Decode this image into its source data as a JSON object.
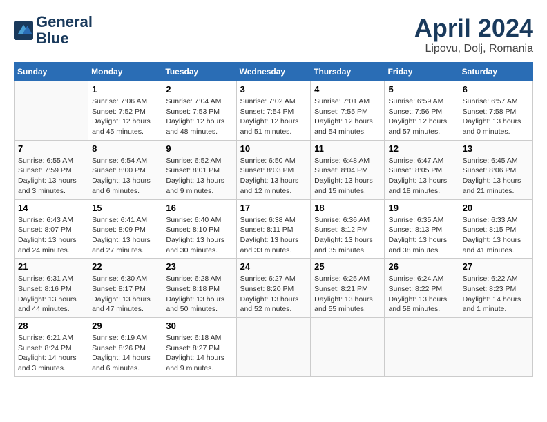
{
  "logo": {
    "line1": "General",
    "line2": "Blue"
  },
  "title": "April 2024",
  "location": "Lipovu, Dolj, Romania",
  "header_days": [
    "Sunday",
    "Monday",
    "Tuesday",
    "Wednesday",
    "Thursday",
    "Friday",
    "Saturday"
  ],
  "weeks": [
    [
      null,
      {
        "day": "1",
        "sunrise": "7:06 AM",
        "sunset": "7:52 PM",
        "daylight": "12 hours and 45 minutes."
      },
      {
        "day": "2",
        "sunrise": "7:04 AM",
        "sunset": "7:53 PM",
        "daylight": "12 hours and 48 minutes."
      },
      {
        "day": "3",
        "sunrise": "7:02 AM",
        "sunset": "7:54 PM",
        "daylight": "12 hours and 51 minutes."
      },
      {
        "day": "4",
        "sunrise": "7:01 AM",
        "sunset": "7:55 PM",
        "daylight": "12 hours and 54 minutes."
      },
      {
        "day": "5",
        "sunrise": "6:59 AM",
        "sunset": "7:56 PM",
        "daylight": "12 hours and 57 minutes."
      },
      {
        "day": "6",
        "sunrise": "6:57 AM",
        "sunset": "7:58 PM",
        "daylight": "13 hours and 0 minutes."
      }
    ],
    [
      {
        "day": "7",
        "sunrise": "6:55 AM",
        "sunset": "7:59 PM",
        "daylight": "13 hours and 3 minutes."
      },
      {
        "day": "8",
        "sunrise": "6:54 AM",
        "sunset": "8:00 PM",
        "daylight": "13 hours and 6 minutes."
      },
      {
        "day": "9",
        "sunrise": "6:52 AM",
        "sunset": "8:01 PM",
        "daylight": "13 hours and 9 minutes."
      },
      {
        "day": "10",
        "sunrise": "6:50 AM",
        "sunset": "8:03 PM",
        "daylight": "13 hours and 12 minutes."
      },
      {
        "day": "11",
        "sunrise": "6:48 AM",
        "sunset": "8:04 PM",
        "daylight": "13 hours and 15 minutes."
      },
      {
        "day": "12",
        "sunrise": "6:47 AM",
        "sunset": "8:05 PM",
        "daylight": "13 hours and 18 minutes."
      },
      {
        "day": "13",
        "sunrise": "6:45 AM",
        "sunset": "8:06 PM",
        "daylight": "13 hours and 21 minutes."
      }
    ],
    [
      {
        "day": "14",
        "sunrise": "6:43 AM",
        "sunset": "8:07 PM",
        "daylight": "13 hours and 24 minutes."
      },
      {
        "day": "15",
        "sunrise": "6:41 AM",
        "sunset": "8:09 PM",
        "daylight": "13 hours and 27 minutes."
      },
      {
        "day": "16",
        "sunrise": "6:40 AM",
        "sunset": "8:10 PM",
        "daylight": "13 hours and 30 minutes."
      },
      {
        "day": "17",
        "sunrise": "6:38 AM",
        "sunset": "8:11 PM",
        "daylight": "13 hours and 33 minutes."
      },
      {
        "day": "18",
        "sunrise": "6:36 AM",
        "sunset": "8:12 PM",
        "daylight": "13 hours and 35 minutes."
      },
      {
        "day": "19",
        "sunrise": "6:35 AM",
        "sunset": "8:13 PM",
        "daylight": "13 hours and 38 minutes."
      },
      {
        "day": "20",
        "sunrise": "6:33 AM",
        "sunset": "8:15 PM",
        "daylight": "13 hours and 41 minutes."
      }
    ],
    [
      {
        "day": "21",
        "sunrise": "6:31 AM",
        "sunset": "8:16 PM",
        "daylight": "13 hours and 44 minutes."
      },
      {
        "day": "22",
        "sunrise": "6:30 AM",
        "sunset": "8:17 PM",
        "daylight": "13 hours and 47 minutes."
      },
      {
        "day": "23",
        "sunrise": "6:28 AM",
        "sunset": "8:18 PM",
        "daylight": "13 hours and 50 minutes."
      },
      {
        "day": "24",
        "sunrise": "6:27 AM",
        "sunset": "8:20 PM",
        "daylight": "13 hours and 52 minutes."
      },
      {
        "day": "25",
        "sunrise": "6:25 AM",
        "sunset": "8:21 PM",
        "daylight": "13 hours and 55 minutes."
      },
      {
        "day": "26",
        "sunrise": "6:24 AM",
        "sunset": "8:22 PM",
        "daylight": "13 hours and 58 minutes."
      },
      {
        "day": "27",
        "sunrise": "6:22 AM",
        "sunset": "8:23 PM",
        "daylight": "14 hours and 1 minute."
      }
    ],
    [
      {
        "day": "28",
        "sunrise": "6:21 AM",
        "sunset": "8:24 PM",
        "daylight": "14 hours and 3 minutes."
      },
      {
        "day": "29",
        "sunrise": "6:19 AM",
        "sunset": "8:26 PM",
        "daylight": "14 hours and 6 minutes."
      },
      {
        "day": "30",
        "sunrise": "6:18 AM",
        "sunset": "8:27 PM",
        "daylight": "14 hours and 9 minutes."
      },
      null,
      null,
      null,
      null
    ]
  ],
  "labels": {
    "sunrise": "Sunrise:",
    "sunset": "Sunset:",
    "daylight": "Daylight:"
  }
}
